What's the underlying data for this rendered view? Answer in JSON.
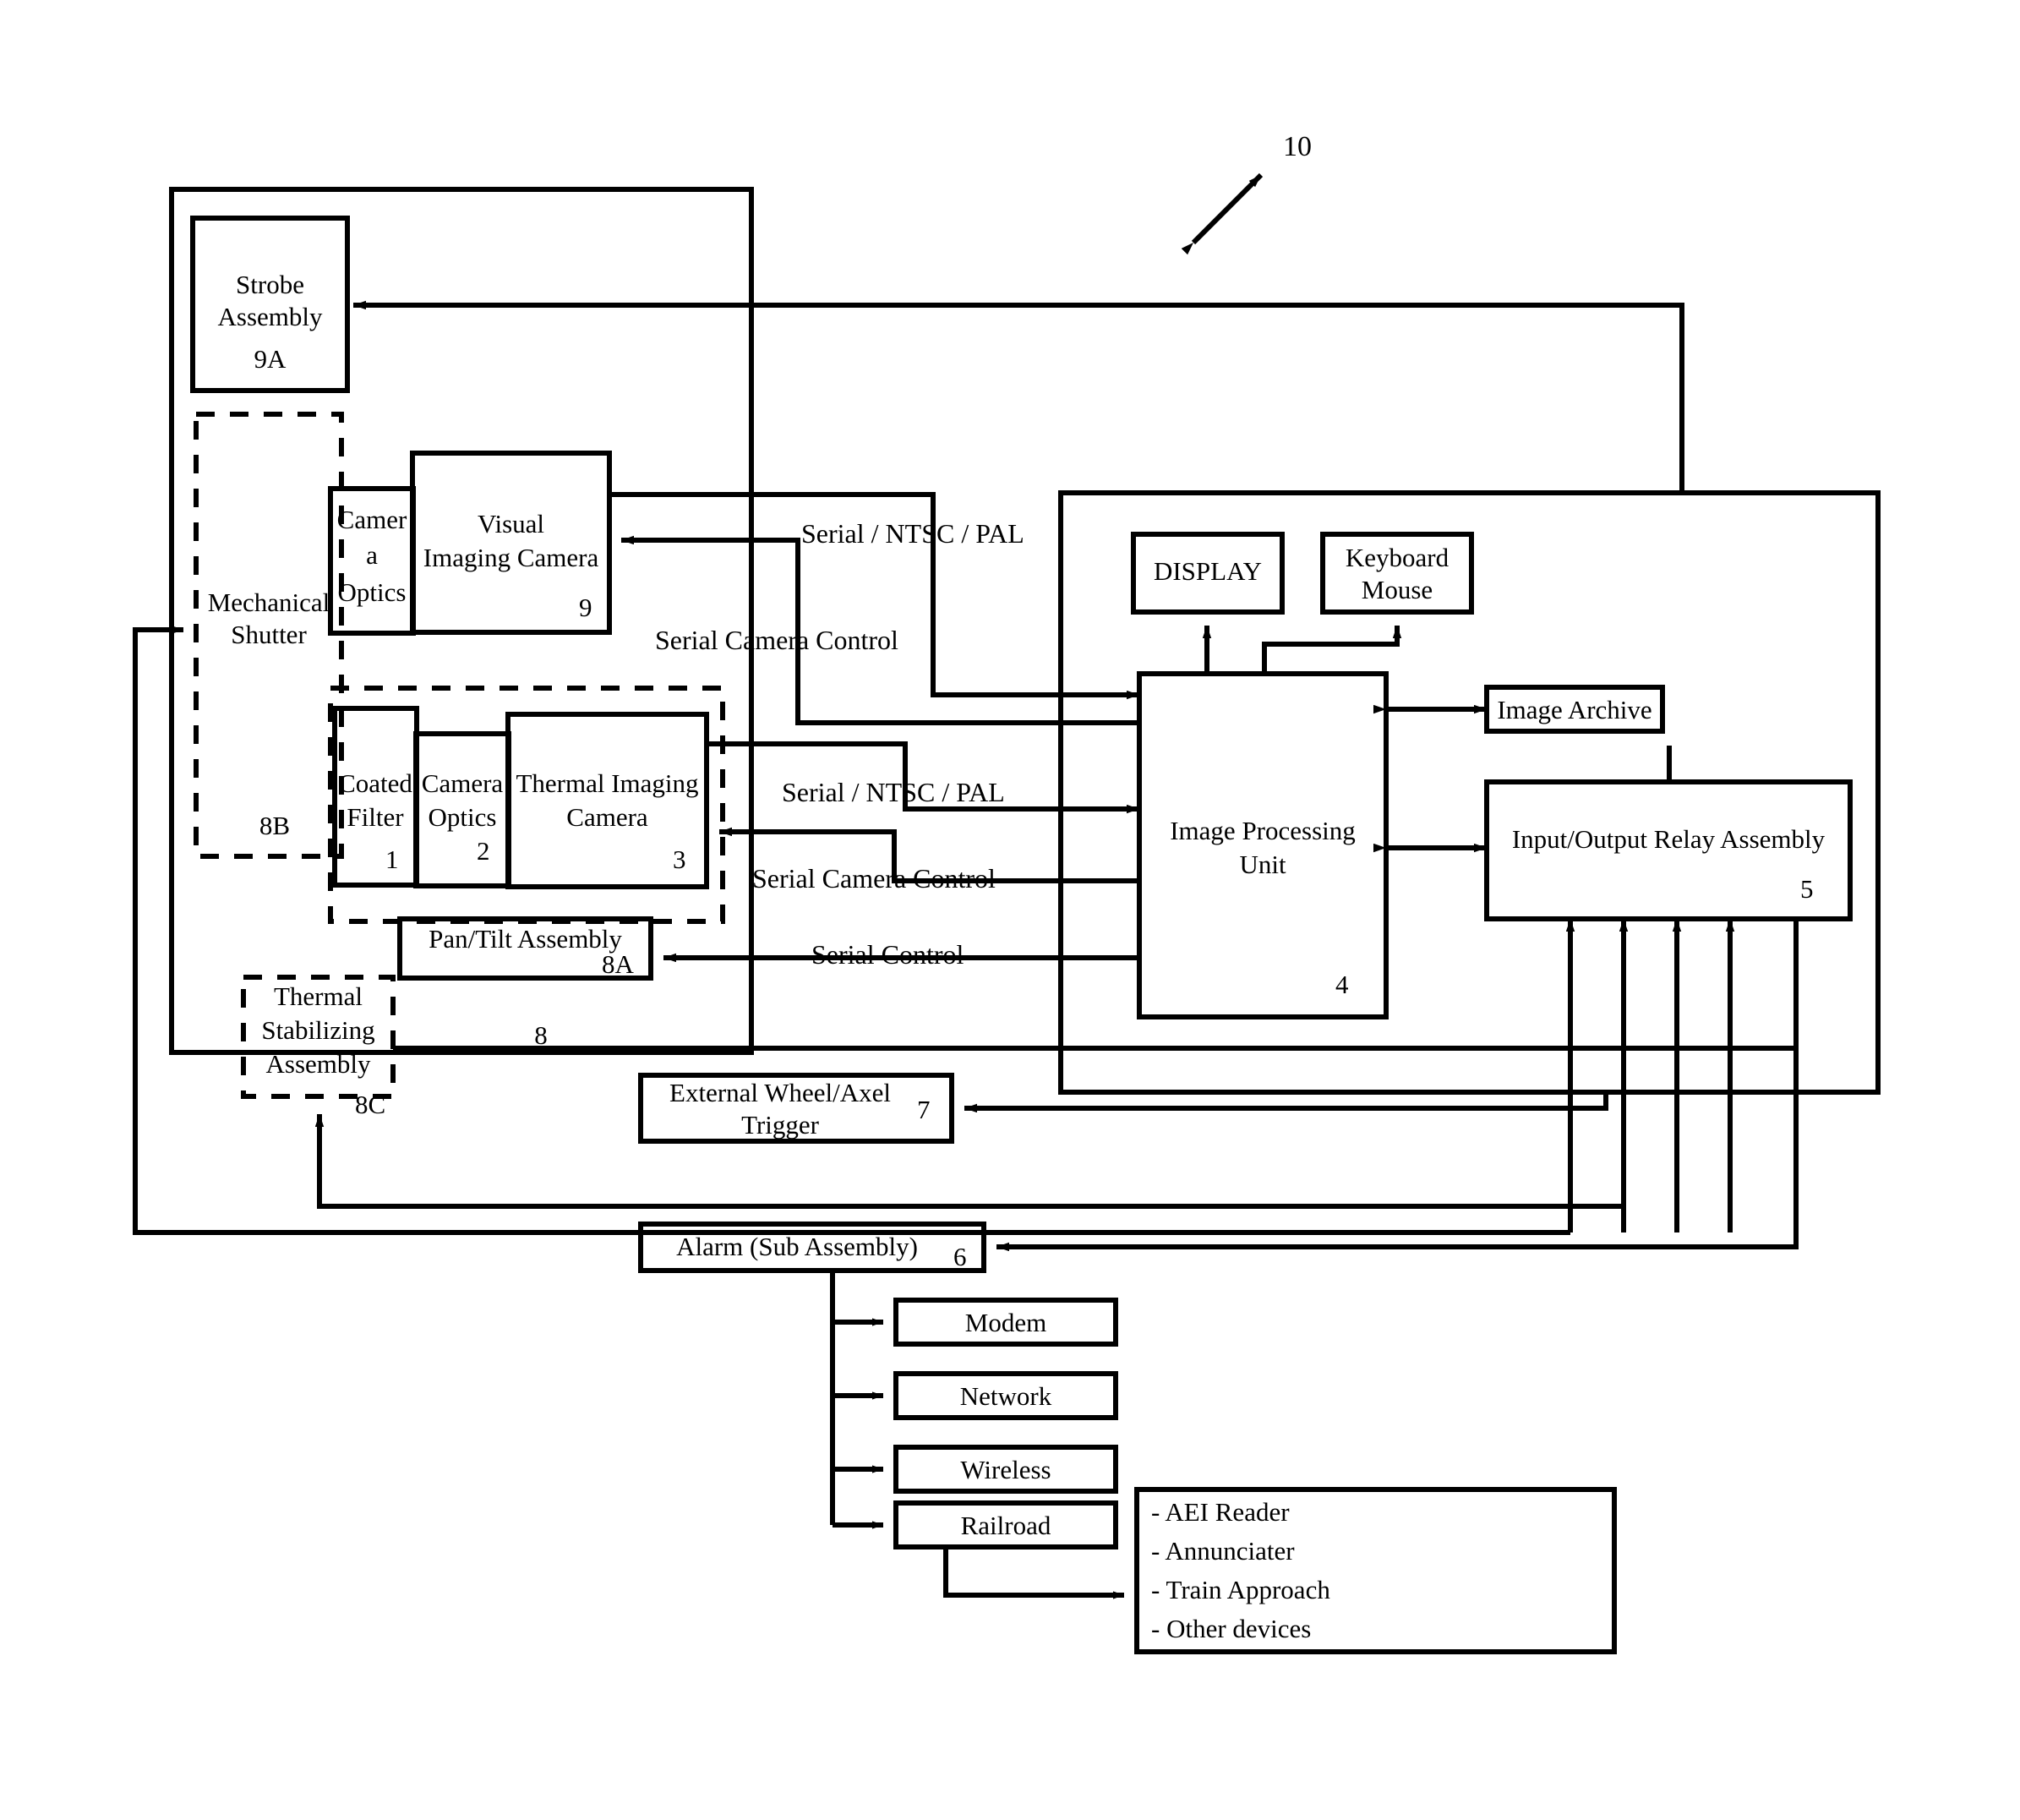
{
  "figure": {
    "reference_numeral": "10",
    "type": "patent-block-diagram"
  },
  "blocks": {
    "strobe_assembly": {
      "label": "Strobe\nAssembly",
      "line1": "Strobe",
      "line2": "Assembly",
      "ref": "9A"
    },
    "mechanical_shutter": {
      "line1": "Mechanical",
      "line2": "Shutter",
      "ref": "8B"
    },
    "camera_optics_visual": {
      "line1": "Camer",
      "line2": "a",
      "line3": "Optics",
      "ref": ""
    },
    "visual_imaging_camera": {
      "line1": "Visual",
      "line2": "Imaging Camera",
      "ref": "9"
    },
    "coated_filter": {
      "line1": "Coated",
      "line2": "Filter",
      "ref": "1"
    },
    "camera_optics_thermal": {
      "line1": "Camera",
      "line2": "Optics",
      "ref": "2"
    },
    "thermal_imaging_camera": {
      "line1": "Thermal Imaging",
      "line2": "Camera",
      "ref": "3"
    },
    "pan_tilt_assembly": {
      "line1": "Pan/Tilt Assembly",
      "ref": "8A"
    },
    "thermal_stabilizing": {
      "line1": "Thermal",
      "line2": "Stabilizing",
      "line3": "Assembly",
      "ref": "8C"
    },
    "camera_enclosure": {
      "ref": "8"
    },
    "display": {
      "line1": "DISPLAY",
      "ref": ""
    },
    "keyboard_mouse": {
      "line1": "Keyboard",
      "line2": "Mouse",
      "ref": ""
    },
    "image_archive": {
      "line1": "Image Archive",
      "ref": ""
    },
    "image_processing_unit": {
      "line1": "Image Processing",
      "line2": "Unit",
      "ref": "4"
    },
    "io_relay_assembly": {
      "line1": "Input/Output Relay Assembly",
      "ref": "5"
    },
    "external_trigger": {
      "line1": "External Wheel/Axel",
      "line2": "Trigger",
      "ref": "7"
    },
    "alarm_sub_assembly": {
      "line1": "Alarm (Sub Assembly)",
      "ref": "6"
    },
    "modem": {
      "line1": "Modem",
      "ref": ""
    },
    "network": {
      "line1": "Network",
      "ref": ""
    },
    "wireless": {
      "line1": "Wireless",
      "ref": ""
    },
    "railroad": {
      "line1": "Railroad",
      "ref": ""
    },
    "railroad_devices": {
      "items": [
        "- AEI Reader",
        "- Annunciater",
        "- Train Approach",
        "- Other devices"
      ]
    }
  },
  "signal_labels": {
    "visual_video": "Serial / NTSC / PAL",
    "visual_control": "Serial Camera Control",
    "thermal_video": "Serial / NTSC / PAL",
    "thermal_control": "Serial Camera Control",
    "pan_tilt_control": "Serial Control"
  },
  "colors": {
    "stroke": "#000000",
    "background": "#ffffff"
  }
}
